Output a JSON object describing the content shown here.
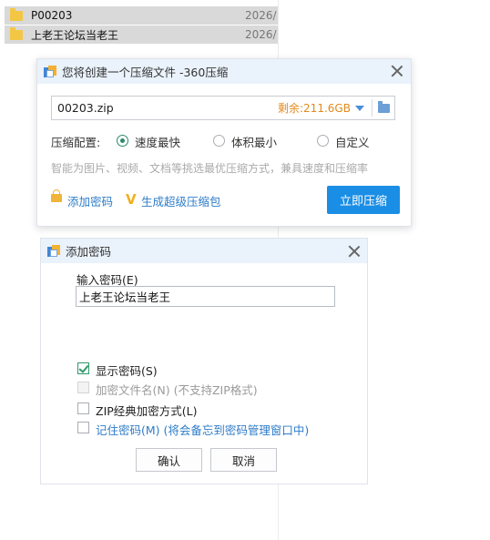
{
  "explorer": {
    "files": [
      {
        "name": "P00203",
        "date": "2026/"
      },
      {
        "name": "上老王论坛当老王",
        "date": "2026/"
      }
    ]
  },
  "compress_dialog": {
    "title": "您将创建一个压缩文件 -360压缩",
    "filename": "00203.zip",
    "free_space": "剩余:211.6GB",
    "config_label": "压缩配置:",
    "options": [
      "速度最快",
      "体积最小",
      "自定义"
    ],
    "selected_option": "速度最快",
    "hint": "智能为图片、视频、文档等挑选最优压缩方式，兼具速度和压缩率",
    "add_password": "添加密码",
    "super_package": "生成超级压缩包",
    "compress_button": "立即压缩"
  },
  "password_dialog": {
    "title": "添加密码",
    "input_label": "输入密码(E)",
    "password_value": "上老王论坛当老王",
    "show_password": "显示密码(S)",
    "encrypt_filenames": "加密文件名(N) (不支持ZIP格式)",
    "zip_classic": "ZIP经典加密方式(L)",
    "remember_password": "记住密码(M) (将会备忘到密码管理窗口中)",
    "confirm_button": "确认",
    "cancel_button": "取消",
    "checkbox_states": {
      "show_password": true,
      "encrypt_filenames": false,
      "zip_classic": false,
      "remember_password": false
    }
  },
  "colors": {
    "accent": "#1a8ee5",
    "free_space": "#e28a1a",
    "link": "#2e7cc8",
    "check": "#2f9a6a",
    "titlebar": "#eaf2fb"
  },
  "icons": [
    "folder-icon",
    "app-icon",
    "close-icon",
    "dropdown-icon",
    "lock-icon",
    "v-icon"
  ]
}
